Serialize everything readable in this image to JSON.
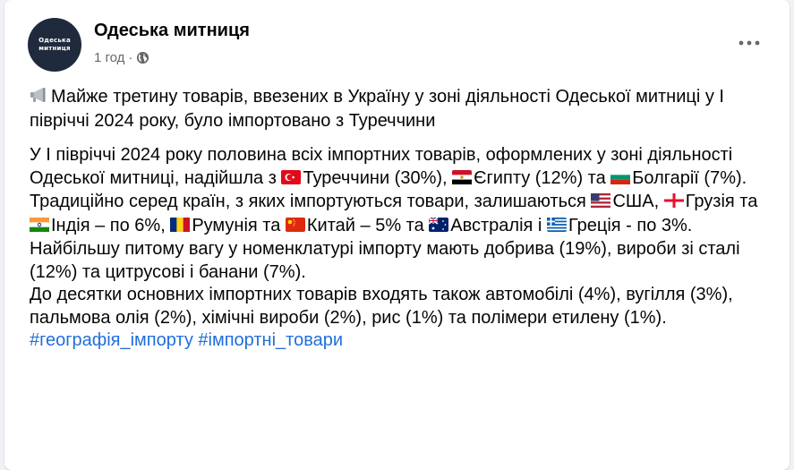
{
  "post": {
    "author": "Одеська митниця",
    "avatar_text_line1": "Одеська",
    "avatar_text_line2": "митниця",
    "time": "1 год",
    "separator": "·",
    "privacy_icon": "globe-icon",
    "more_icon": "more-options-icon"
  },
  "headline": "Майже третину товарів, ввезених в Україну у зоні діяльності Одеської митниці у І півріччі 2024 року, було імпортовано з Туреччини",
  "body": {
    "s1a": "У І півріччі 2024 року половина всіх імпортних товарів, оформлених у зоні діяльності Одеської митниці, надійшла з ",
    "turkey": "Туреччини (30%), ",
    "egypt": "Єгипту (12%) та ",
    "bulgaria": "Болгарії (7%).",
    "s2a": "Традиційно серед країн, з яких імпортуються товари, залишаються ",
    "usa": "США, ",
    "georgia": "Грузія та ",
    "india": "Індія – по 6%, ",
    "romania": "Румунія та ",
    "china": "Китай – 5% та ",
    "australia": "Австралія і ",
    "greece": "Греція - по 3%.",
    "s3": "Найбільшу питому вагу у номенклатурі імпорту мають добрива (19%), вироби зі сталі (12%) та цитрусові і банани (7%).",
    "s4": "До десятки основних імпортних товарів входять також автомобілі (4%), вугілля (3%), пальмова олія (2%), хімічні вироби (2%), рис (1%) та полімери етилену (1%)."
  },
  "hashtags": [
    "#географія_імпорту",
    "#імпортні_товари"
  ],
  "colors": {
    "hashtag": "#216fdb",
    "text": "#050505",
    "secondary": "#65676b"
  }
}
